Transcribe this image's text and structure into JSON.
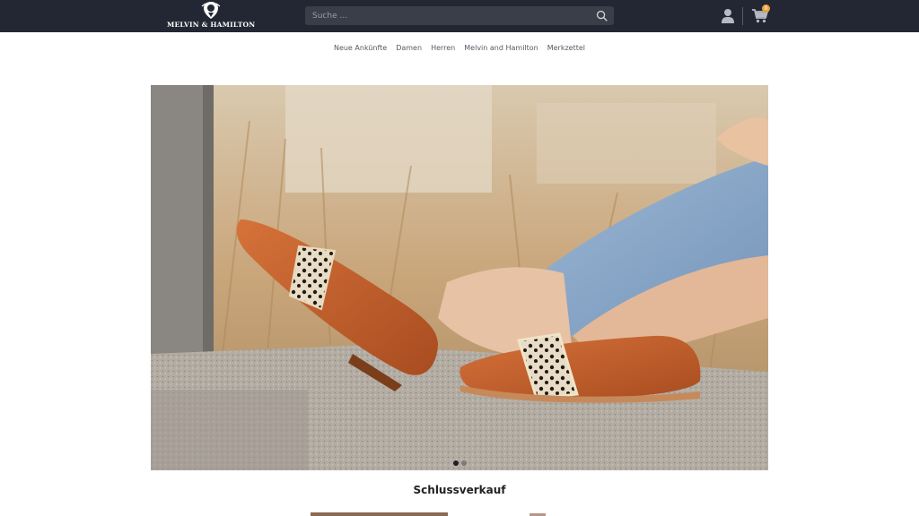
{
  "header": {
    "logo_text": "MELVIN & HAMILTON",
    "search": {
      "placeholder": "Suche ..."
    },
    "cart": {
      "badge": "0"
    },
    "icons": [
      "search-icon",
      "user-icon",
      "cart-icon"
    ]
  },
  "nav": {
    "items": [
      {
        "label": "Neue Ankünfte"
      },
      {
        "label": "Damen"
      },
      {
        "label": "Herren"
      },
      {
        "label": "Melvin and Hamilton"
      },
      {
        "label": "Merkzettel"
      }
    ]
  },
  "hero": {
    "slides_total": 2,
    "active_slide": 1
  },
  "section": {
    "title": "Schlussverkauf"
  },
  "colors": {
    "header_bg": "#232733",
    "badge": "#e8a23b",
    "nav_text": "#555a66"
  }
}
